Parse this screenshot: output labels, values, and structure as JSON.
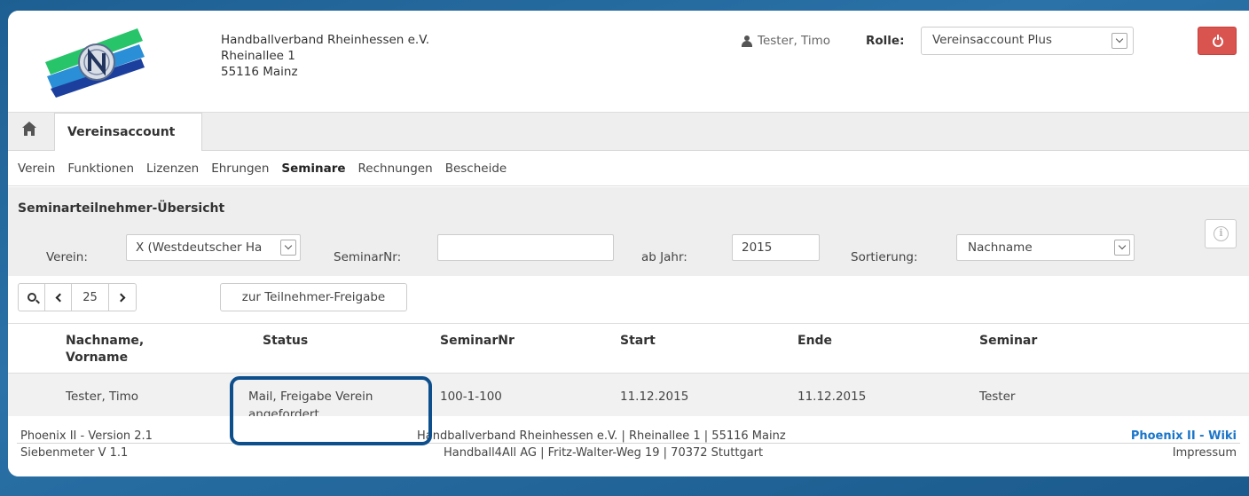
{
  "header": {
    "org_name": "Handballverband Rheinhessen e.V.",
    "street": "Rheinallee 1",
    "city": "55116 Mainz",
    "user_name": "Tester, Timo",
    "role_label": "Rolle:",
    "role_value": "Vereinsaccount Plus",
    "icons": {
      "user": "user-icon",
      "logout": "power-icon",
      "dropdown": "chevron-down-icon"
    },
    "logout_color": "#d9534f"
  },
  "tabs": {
    "home_icon": "home-icon",
    "active": "Vereinsaccount"
  },
  "subnav": {
    "items": [
      {
        "label": "Verein"
      },
      {
        "label": "Funktionen"
      },
      {
        "label": "Lizenzen"
      },
      {
        "label": "Ehrungen"
      },
      {
        "label": "Seminare",
        "active": true
      },
      {
        "label": "Rechnungen"
      },
      {
        "label": "Bescheide"
      }
    ]
  },
  "filter": {
    "title": "Seminarteilnehmer-Übersicht",
    "verein_label": "Verein:",
    "verein_value": "X (Westdeutscher Ha",
    "seminarnr_label": "SeminarNr:",
    "seminarnr_value": "",
    "jahr_label": "ab Jahr:",
    "jahr_value": "2015",
    "sort_label": "Sortierung:",
    "sort_value": "Nachname",
    "info_icon": "info-icon"
  },
  "toolbar": {
    "page_size": "25",
    "freigabe_label": "zur Teilnehmer-Freigabe",
    "icons": [
      "search-icon",
      "chevron-left-icon",
      "chevron-right-icon"
    ]
  },
  "table": {
    "columns": [
      "Nachname, Vorname",
      "Status",
      "SeminarNr",
      "Start",
      "Ende",
      "Seminar"
    ],
    "rows": [
      {
        "name": "Tester, Timo",
        "status_line1": "Mail, Freigabe Verein",
        "status_line2": "angefordert",
        "seminarnr": "100-1-100",
        "start": "11.12.2015",
        "ende": "11.12.2015",
        "seminar": "Tester"
      }
    ]
  },
  "footer": {
    "version": "Phoenix II - Version 2.1",
    "sub_version": "Siebenmeter V 1.1",
    "org_line": "Handballverband Rheinhessen e.V. | Rheinallee 1 | 55116 Mainz",
    "vendor_line": "Handball4All AG | Fritz-Walter-Weg 19 | 70372 Stuttgart",
    "wiki_link": "Phoenix II - Wiki",
    "impressum_link": "Impressum",
    "link_color": "#1a75c9"
  },
  "annotation": {
    "highlight_color": "#0d4f8c"
  }
}
